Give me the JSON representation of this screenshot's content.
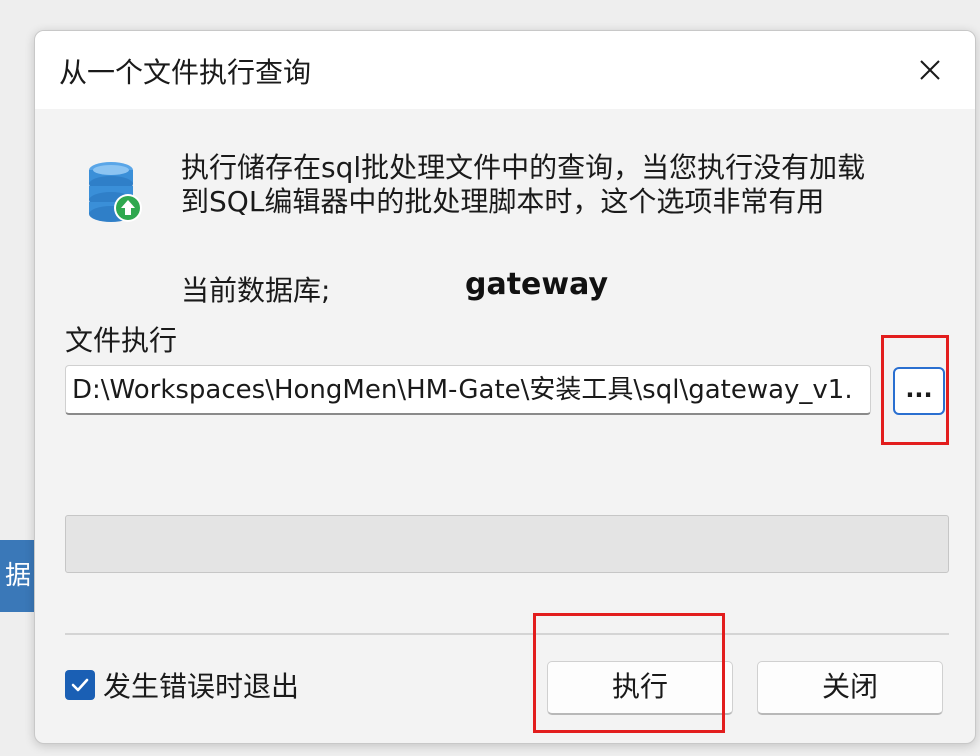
{
  "background": {
    "partial_tab_text": "据"
  },
  "dialog": {
    "title": "从一个文件执行查询",
    "close_icon": "close-icon",
    "description_line1": "执行储存在sql批处理文件中的查询，当您执行没有加载",
    "description_line2": "到SQL编辑器中的批处理脚本时，这个选项非常有用",
    "current_db_label": "当前数据库;",
    "current_db_value": "gateway",
    "file_label": "文件执行",
    "file_path": "D:\\Workspaces\\HongMen\\HM-Gate\\安装工具\\sql\\gateway_v1.",
    "browse_label": "...",
    "progress_fraction": 0,
    "exit_on_error_label": "发生错误时退出",
    "exit_on_error_checked": true,
    "execute_label": "执行",
    "close_label": "关闭"
  },
  "icons": {
    "database_icon": "database-upload-icon",
    "check_icon": "checkmark-icon"
  },
  "colors": {
    "accent": "#1a5fb4",
    "highlight": "#e21d1d",
    "db_icon_blue": "#3a8fd8",
    "db_icon_green": "#2fa84f"
  }
}
